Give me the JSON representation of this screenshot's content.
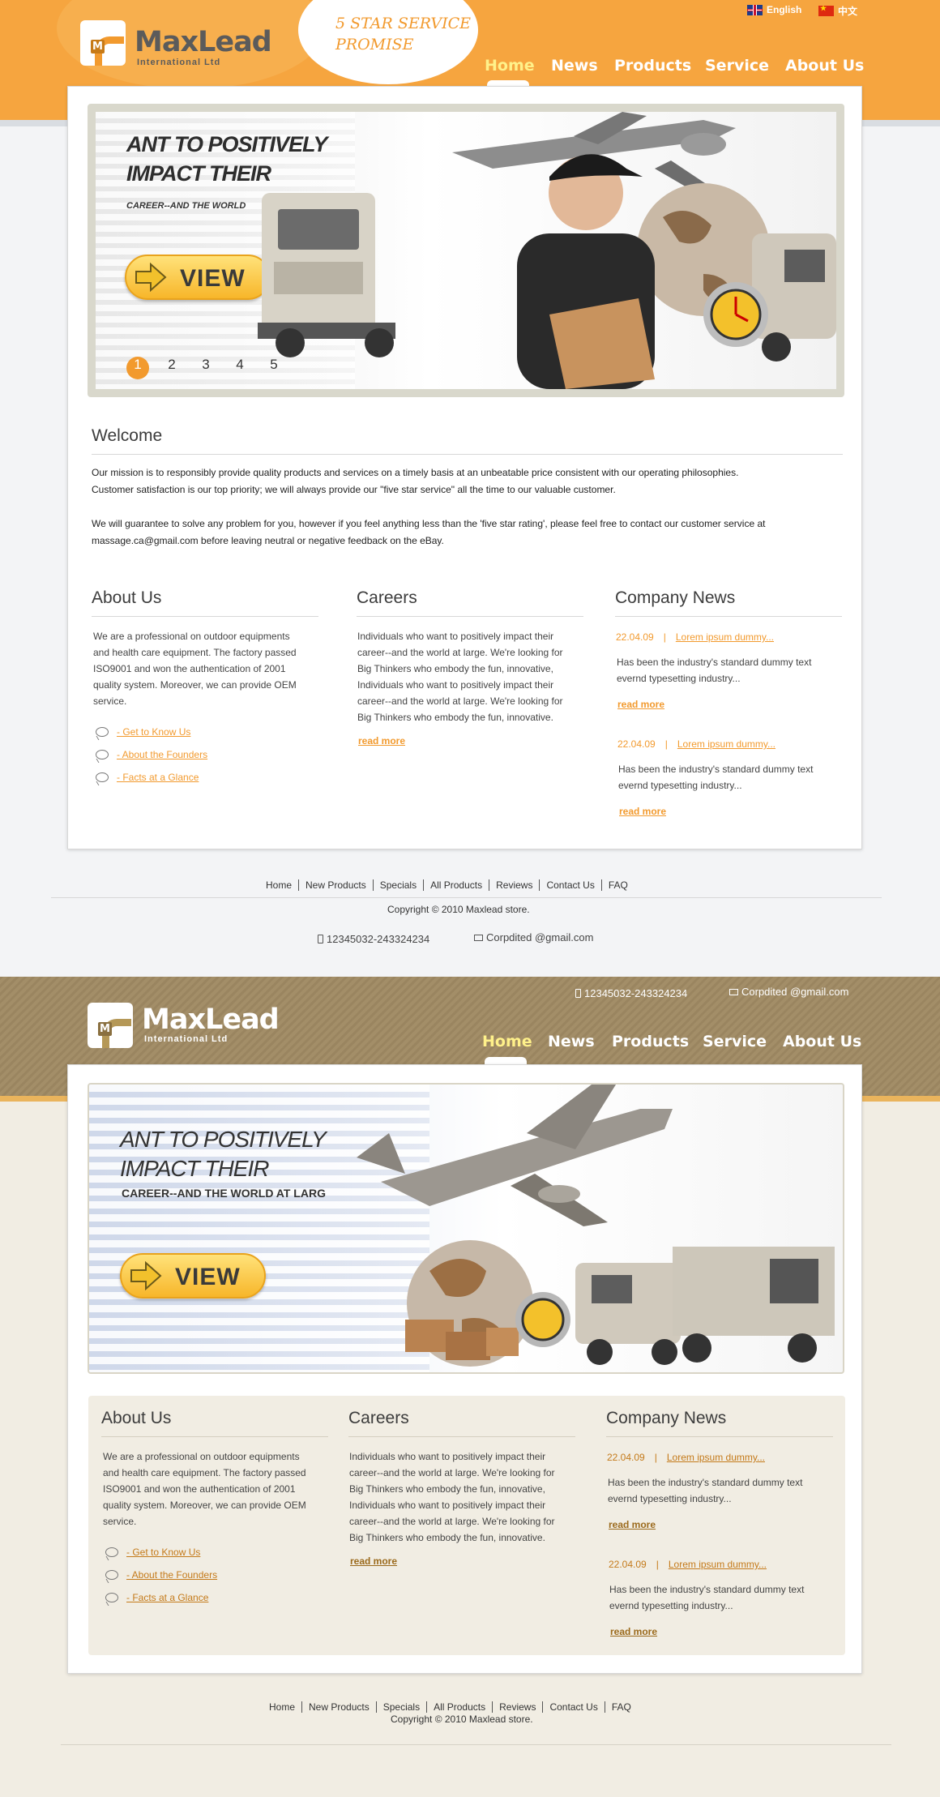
{
  "header": {
    "slogan": "5 STAR SERVICE PROMISE",
    "logo_name": "MaxLead",
    "logo_sub": "International Ltd",
    "logo_mark": "M",
    "languages": [
      {
        "label": "English",
        "icon": "uk-flag-icon"
      },
      {
        "label": "中文",
        "icon": "china-flag-icon"
      }
    ],
    "nav": [
      "Home",
      "News",
      "Products",
      "Service",
      "About Us"
    ],
    "active_nav": "Home"
  },
  "slider": {
    "headline_1": "ANT TO POSITIVELY",
    "headline_2": "IMPACT THEIR",
    "subline": "CAREER--AND THE WORLD",
    "button": "VIEW",
    "pages": [
      "1",
      "2",
      "3",
      "4",
      "5"
    ],
    "active_page": "1"
  },
  "welcome": {
    "title": "Welcome",
    "p1_line1": "Our mission is to responsibly provide quality products and services on a timely basis at an unbeatable price consistent with our operating philosophies.",
    "p1_line2": "Customer satisfaction is our top priority; we will always provide our \"five star service\" all the time to our valuable customer.",
    "p2_line1": "We will guarantee to solve any problem for you, however if you feel anything less than the 'five star rating', please feel free to contact our customer service at",
    "p2_line2": "massage.ca@gmail.com before leaving neutral or negative feedback on the eBay."
  },
  "about": {
    "title": "About Us",
    "text": [
      " We are a professional on outdoor equipments",
      "and health care equipment. The factory passed",
      "ISO9001 and won the authentication of 2001",
      "quality system.  Moreover, we can provide OEM",
      "service."
    ],
    "links": [
      "- Get to Know Us ",
      "- About the Founders ",
      "- Facts at a Glance "
    ]
  },
  "careers": {
    "title": "Careers",
    "text": [
      "Individuals who want to positively impact their",
      "career--and the world at large. We're looking for",
      "Big Thinkers who embody the fun, innovative,",
      "Individuals who want to positively impact their",
      "career--and the world at large. We're looking for",
      "Big Thinkers who embody the fun, innovative."
    ],
    "read_more": "read more"
  },
  "news": {
    "title": "Company News",
    "items": [
      {
        "date": "22.04.09",
        "link": "Lorem ipsum dummy...",
        "text_1": "Has been the industry's standard dummy text",
        "text_2": "evernd typesetting industry...",
        "read_more": "read more"
      },
      {
        "date": "22.04.09",
        "link": "Lorem ipsum dummy...",
        "text_1": "Has been the industry's standard dummy text",
        "text_2": "evernd typesetting industry...",
        "read_more": "read more"
      }
    ]
  },
  "footer": {
    "links": [
      "Home",
      "New Products",
      "Specials",
      "All Products",
      "Reviews",
      "Contact Us",
      "FAQ"
    ],
    "copyright": "Copyright © 2010 Maxlead store.",
    "phone": "12345032-243324234",
    "email": "Corpdited @gmail.com"
  },
  "slider2": {
    "headline_1": "ANT TO POSITIVELY",
    "headline_2": "IMPACT THEIR",
    "subline": "CAREER--AND THE WORLD AT LARG",
    "button": "VIEW"
  },
  "colors": {
    "orange": "#f6a53f",
    "accent": "#f29a2e",
    "brown": "#9a8560",
    "cream": "#f1ede3"
  }
}
